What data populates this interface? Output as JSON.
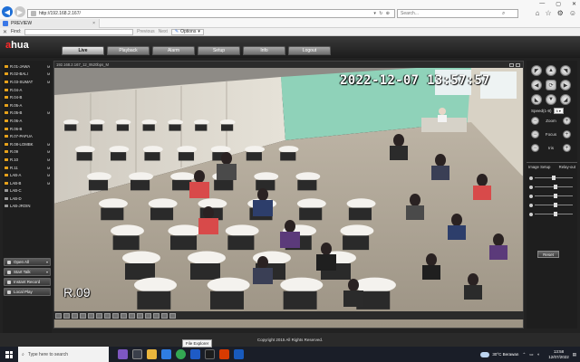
{
  "browser": {
    "url": "http://192.168.2.167/",
    "search_placeholder": "Search...",
    "tab_label": "PREVIEW",
    "tab_close": "×",
    "find_label": "Find:",
    "find_prev": "Previous",
    "find_next": "Next",
    "options_label": "Options"
  },
  "app": {
    "brand_a": "a",
    "brand_rest": "hua",
    "tabs": [
      "Live",
      "Playback",
      "Alarm",
      "Setup",
      "Info",
      "Logout"
    ],
    "active_tab": "Live"
  },
  "channels": [
    {
      "name": "R.01-JAWA",
      "status": "M",
      "active": true
    },
    {
      "name": "R.02-BALI",
      "status": "M",
      "active": true
    },
    {
      "name": "R.03-SUMAT",
      "status": "M",
      "active": true
    },
    {
      "name": "R.04-A",
      "status": "",
      "active": true
    },
    {
      "name": "R.04-B",
      "status": "",
      "active": true
    },
    {
      "name": "R.05-A",
      "status": "",
      "active": true
    },
    {
      "name": "R.05-B",
      "status": "M",
      "active": true
    },
    {
      "name": "R.06-A",
      "status": "",
      "active": true
    },
    {
      "name": "R.06-B",
      "status": "",
      "active": true
    },
    {
      "name": "R.07-PAPUA",
      "status": "",
      "active": true
    },
    {
      "name": "R.08-LOMBK",
      "status": "M",
      "active": true
    },
    {
      "name": "R.09",
      "status": "M",
      "active": true
    },
    {
      "name": "R.10",
      "status": "M",
      "active": true
    },
    {
      "name": "R.11",
      "status": "M",
      "active": true
    },
    {
      "name": "LAB-A",
      "status": "M",
      "active": true
    },
    {
      "name": "LAB-B",
      "status": "M",
      "active": true
    },
    {
      "name": "LAB-C",
      "status": "",
      "active": false
    },
    {
      "name": "LAB-D",
      "status": "",
      "active": false
    },
    {
      "name": "LAB-JROIN",
      "status": "",
      "active": false
    }
  ],
  "side_buttons": [
    {
      "label": "Open All",
      "dropdown": true
    },
    {
      "label": "Start Talk",
      "dropdown": true
    },
    {
      "label": "Instant Record",
      "dropdown": false
    },
    {
      "label": "Local Play",
      "dropdown": false
    }
  ],
  "video": {
    "info": "192.168.2.167_12_9520bps_M",
    "osd_time": "2022-12-07 13:57:57",
    "osd_name": "R.09"
  },
  "ptz": {
    "speed_label": "Speed(1-8)",
    "speed_value": "5",
    "zoom_label": "Zoom",
    "focus_label": "Focus",
    "iris_label": "Iris",
    "arrows": [
      "◤",
      "▲",
      "◥",
      "◀",
      "⟳",
      "▶",
      "◣",
      "▼",
      "◢"
    ]
  },
  "image_setup": {
    "title": "Image Setup",
    "relay": "Relay-out",
    "reset_label": "Reset",
    "levels": [
      0.45,
      0.5,
      0.5,
      0.5,
      0.5
    ]
  },
  "footer": {
    "copyright": "Copyright 2015 All Rights Reserved."
  },
  "taskbar": {
    "search_placeholder": "Type here to search",
    "tooltip": "File Explorer",
    "weather": "30°C  Berawan",
    "time": "13:58",
    "date": "12/07/2022"
  },
  "colors": {
    "accent": "#1f6fd6",
    "camera_active": "#e8a21a",
    "brand_red": "#ff2a2a"
  }
}
